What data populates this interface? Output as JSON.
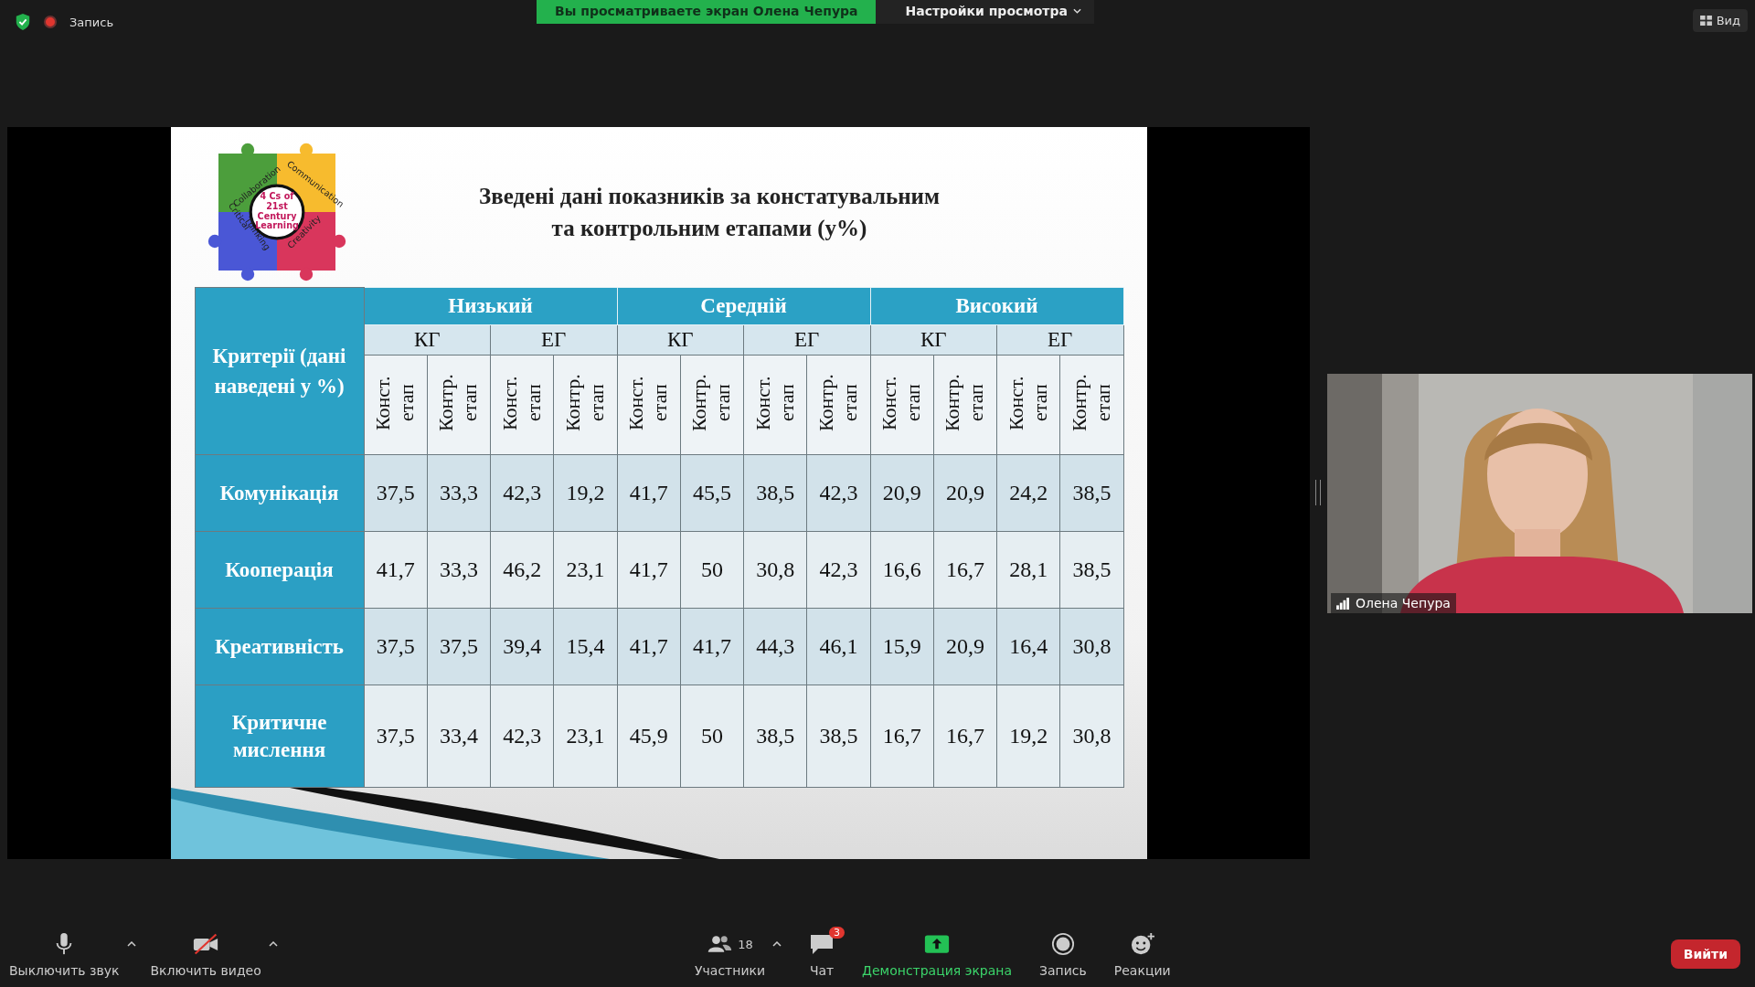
{
  "top_bar": {
    "recording_label": "Запись",
    "sharing_banner": "Вы просматриваете экран Олена Чепура",
    "view_options": "Настройки просмотра",
    "view_button": "Вид"
  },
  "slide": {
    "title_lines": [
      "Зведені дані показників за констатувальним",
      "та контрольним етапами (у%)"
    ],
    "logo": {
      "pieces": [
        "Collaboration",
        "Communication",
        "Critical",
        "Thinking",
        "Creativity"
      ],
      "center": "4 Cs of 21st Century Learning"
    },
    "table": {
      "criteria_header": "Критерії (дані наведені у %)",
      "levels": [
        {
          "label": "Низький",
          "groups": [
            {
              "label": "КГ",
              "stages": [
                "Конст. етап",
                "Контр. етап"
              ]
            },
            {
              "label": "ЕГ",
              "stages": [
                "Конст. етап",
                "Контр. етап"
              ]
            }
          ]
        },
        {
          "label": "Середній",
          "groups": [
            {
              "label": "КГ",
              "stages": [
                "Конст. етап",
                "Контр. етап"
              ]
            },
            {
              "label": "ЕГ",
              "stages": [
                "Конст. етап",
                "Контр. етап"
              ]
            }
          ]
        },
        {
          "label": "Високий",
          "groups": [
            {
              "label": "КГ",
              "stages": [
                "Конст. етап",
                "Контр. етап"
              ]
            },
            {
              "label": "ЕГ",
              "stages": [
                "Конст. етап",
                "Контр. етап"
              ]
            }
          ]
        }
      ],
      "rows": [
        {
          "label": "Комунікація",
          "cells": [
            "37,5",
            "33,3",
            "42,3",
            "19,2",
            "41,7",
            "45,5",
            "38,5",
            "42,3",
            "20,9",
            "20,9",
            "24,2",
            "38,5"
          ]
        },
        {
          "label": "Кооперація",
          "cells": [
            "41,7",
            "33,3",
            "46,2",
            "23,1",
            "41,7",
            "50",
            "30,8",
            "42,3",
            "16,6",
            "16,7",
            "28,1",
            "38,5"
          ]
        },
        {
          "label": "Креативність",
          "cells": [
            "37,5",
            "37,5",
            "39,4",
            "15,4",
            "41,7",
            "41,7",
            "44,3",
            "46,1",
            "15,9",
            "20,9",
            "16,4",
            "30,8"
          ]
        },
        {
          "label": "Критичне мислення",
          "cells": [
            "37,5",
            "33,4",
            "42,3",
            "23,1",
            "45,9",
            "50",
            "38,5",
            "38,5",
            "16,7",
            "16,7",
            "19,2",
            "30,8"
          ]
        }
      ]
    }
  },
  "video_tile": {
    "name": "Олена Чепура"
  },
  "toolbar": {
    "items": [
      {
        "kind": "mic",
        "label": "Выключить звук",
        "caret": true
      },
      {
        "kind": "video",
        "label": "Включить видео",
        "caret": true
      },
      {
        "kind": "participants",
        "label": "Участники",
        "count": "18",
        "caret": true
      },
      {
        "kind": "chat",
        "label": "Чат",
        "badge": "3"
      },
      {
        "kind": "share",
        "label": "Демонстрация экрана"
      },
      {
        "kind": "record",
        "label": "Запись"
      },
      {
        "kind": "reactions",
        "label": "Реакции"
      }
    ],
    "leave_button": "Вийти"
  }
}
